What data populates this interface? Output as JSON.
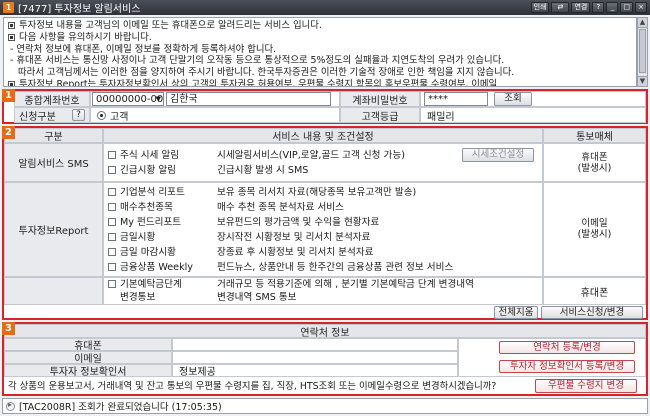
{
  "window": {
    "title": "[7477] 투자정보 알림서비스",
    "badge": "1",
    "controls": [
      "연결",
      "?",
      "_",
      "□",
      "×"
    ],
    "text_controls": [
      "인쇄",
      "⇄"
    ]
  },
  "notice": {
    "lines": [
      "투자정보 내용을 고객님의 이메일 또는 휴대폰으로 알려드리는 서비스 입니다.",
      "다음 사항을 유의하시기 바랍니다.",
      "- 연락처 정보에 휴대폰, 이메일 정보를 정확하게 등록하셔야 합니다.",
      "- 휴대폰 서비스는 통신망 사정이나 고객 단말기의 오작동 등으로 통상적으로 5%정도의 실패율과 지연도착의 우려가 있습니다.",
      "  따라서 고객님께서는 이러한 점을 양지하여 주시기 바랍니다. 한국투자증권은 이러한 기술적 장애로 인한 책임을 지지 않습니다.",
      "투자정보 Report는 투자자정보확인서 상의 고객의 투자권유 허용여부, 우편물 수령지 항목의 홍보우편물 수령여부, 이메일"
    ],
    "bullet_lines": [
      0,
      1,
      5
    ]
  },
  "account": {
    "badge": "1",
    "account_label": "종합계좌번호",
    "account_number": "00000000-00",
    "account_name": "김한국",
    "password_label": "계좌비밀번호",
    "password_value": "****",
    "lookup_button": "조회",
    "applicant_label": "신청구분",
    "help_button": "?",
    "applicant_option": "고객",
    "grade_label": "고객등급",
    "grade_value": "패밀리"
  },
  "services": {
    "badge": "2",
    "col_headers": [
      "구분",
      "서비스 내용 및 조건설정",
      "통보매체"
    ],
    "sms_group": {
      "label": "알림서비스 SMS",
      "items": [
        {
          "name": "주식 시세 알림",
          "desc": "시세알림서비스(VIP,로얄,골드 고객 신청 가능)"
        },
        {
          "name": "긴급시황 알림",
          "desc": "긴급시황 발생 시 SMS"
        }
      ],
      "condition_button": "시세조건설정",
      "media": [
        "휴대폰",
        "(발생시)"
      ]
    },
    "report_group": {
      "label": "투자정보Report",
      "items": [
        {
          "name": "기업분석 리포트",
          "desc": "보유 종목 리서치 자료(해당종목 보유고객만 발송)"
        },
        {
          "name": "매수추천종목",
          "desc": "매수 추천 종목 분석자료 서비스"
        },
        {
          "name": "My 펀드리포트",
          "desc": "보유펀드의 평가금액 및 수익을 현황자료"
        },
        {
          "name": "금일시황",
          "desc": "장시작전 시황정보 및 리서치 분석자료"
        },
        {
          "name": "금일 마감시황",
          "desc": "장종료 후 시황정보 및 리서치 분석자료"
        },
        {
          "name": "금융상품 Weekly",
          "desc": "펀드뉴스, 상품안내 등 한주간의 금융상품 관련 정보 서비스"
        }
      ],
      "media": [
        "이메일",
        "(발생시)"
      ]
    },
    "grade_group": {
      "name_line1": "기본예탁금단계",
      "name_line2": "변경통보",
      "desc_line1": "거래규모 등 적용기준에 의해 , 분기별 기본예탁금 단계 변경내역",
      "desc_line2": "변경내역 SMS 통보",
      "media": "휴대폰"
    },
    "clear_button": "전체지움",
    "apply_button": "서비스신청/변경"
  },
  "contact": {
    "badge": "3",
    "title": "연락처 정보",
    "rows": [
      {
        "label": "휴대폰",
        "value": ""
      },
      {
        "label": "이메일",
        "value": ""
      },
      {
        "label": "투자자 정보확인서",
        "value": "정보제공"
      }
    ],
    "contact_button": "연락처 등록/변경",
    "investor_button": "투자자 정보확인서 등록/변경",
    "mail_question": "각 상품의 운용보고서, 거래내역 및 잔고 통보의 우편물 수령지를 집, 직장, HTS조회 또는 이메일수령으로 변경하시겠습니까?",
    "mail_button": "우편물 수령지 변경"
  },
  "status": {
    "message": "[TAC2008R] 조회가 완료되었습니다 (17:05:35)"
  },
  "colors": {
    "section_border": "#d9232b",
    "section_badge": "#e86a12",
    "titlebar": "#2f3238"
  }
}
